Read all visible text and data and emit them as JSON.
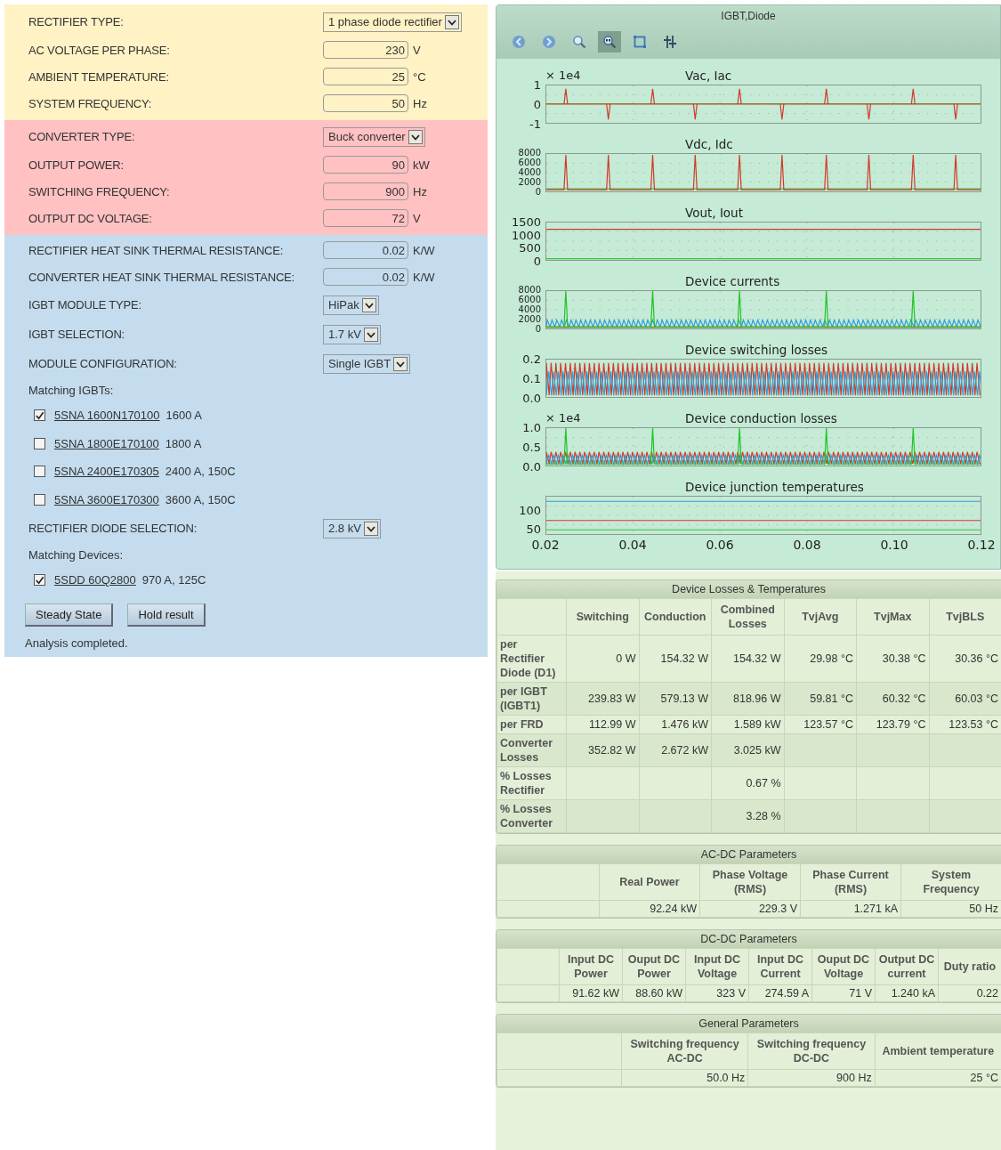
{
  "input_panel": {
    "sections": [
      {
        "color": "#fff2c4",
        "rows": [
          {
            "kind": "select",
            "label": "RECTIFIER TYPE:",
            "value": "1 phase diode rectifier"
          },
          {
            "kind": "number",
            "label": "AC VOLTAGE PER PHASE:",
            "value": "230",
            "unit": "V"
          },
          {
            "kind": "number",
            "label": "AMBIENT TEMPERATURE:",
            "value": "25",
            "unit": "°C"
          },
          {
            "kind": "number",
            "label": "SYSTEM FREQUENCY:",
            "value": "50",
            "unit": "Hz"
          }
        ]
      },
      {
        "color": "#ffc1c1",
        "rows": [
          {
            "kind": "select",
            "label": "CONVERTER TYPE:",
            "value": "Buck converter"
          },
          {
            "kind": "number",
            "label": "OUTPUT POWER:",
            "value": "90",
            "unit": "kW"
          },
          {
            "kind": "number",
            "label": "SWITCHING FREQUENCY:",
            "value": "900",
            "unit": "Hz"
          },
          {
            "kind": "number",
            "label": "OUTPUT DC VOLTAGE:",
            "value": "72",
            "unit": "V"
          }
        ]
      },
      {
        "color": "#c4dcee",
        "rows": [
          {
            "kind": "number",
            "label": "RECTIFIER HEAT SINK THERMAL RESISTANCE:",
            "value": "0.02",
            "unit": "K/W"
          },
          {
            "kind": "number",
            "label": "CONVERTER HEAT SINK THERMAL RESISTANCE:",
            "value": "0.02",
            "unit": "K/W"
          },
          {
            "kind": "select",
            "label": "IGBT MODULE TYPE:",
            "value": "HiPak"
          },
          {
            "kind": "select",
            "label": "IGBT SELECTION:",
            "value": "1.7 kV"
          },
          {
            "kind": "select",
            "label": "MODULE CONFIGURATION:",
            "value": "Single IGBT"
          },
          {
            "kind": "heading",
            "label": "Matching IGBTs:"
          },
          {
            "kind": "checkbox",
            "part": "5SNA 1600N170100",
            "rating": "1600 A",
            "checked": true
          },
          {
            "kind": "checkbox",
            "part": "5SNA 1800E170100",
            "rating": "1800 A",
            "checked": false
          },
          {
            "kind": "checkbox",
            "part": "5SNA 2400E170305",
            "rating": "2400 A, 150C",
            "checked": false
          },
          {
            "kind": "checkbox",
            "part": "5SNA 3600E170300",
            "rating": "3600 A, 150C",
            "checked": false
          },
          {
            "kind": "select",
            "label": "RECTIFIER DIODE SELECTION:",
            "value": "2.8 kV"
          },
          {
            "kind": "heading",
            "label": "Matching Devices:"
          },
          {
            "kind": "checkbox",
            "part": "5SDD 60Q2800",
            "rating": "970 A, 125C",
            "checked": true
          }
        ],
        "buttons": [
          "Steady State",
          "Hold result"
        ],
        "status": "Analysis completed."
      }
    ]
  },
  "plot_panel": {
    "title": "IGBT,Diode",
    "toolbar": [
      {
        "kind": "back",
        "selected": false
      },
      {
        "kind": "forward",
        "selected": false
      },
      {
        "kind": "zoom",
        "selected": false
      },
      {
        "kind": "zoom-rect",
        "selected": true
      },
      {
        "kind": "fit",
        "selected": false
      },
      {
        "kind": "adjust",
        "selected": false
      }
    ],
    "plots": [
      {
        "kind": "ac",
        "title": "Vac, Iac",
        "multiplier": "× 1e4",
        "yticks": [
          "1",
          "0",
          "-1"
        ]
      },
      {
        "kind": "dc",
        "title": "Vdc, Idc",
        "yticks": [
          "8000",
          "6000",
          "4000",
          "2000",
          "0"
        ]
      },
      {
        "kind": "flat",
        "title": "Vout, Iout",
        "yticks": [
          "1500",
          "1000",
          "500",
          "0"
        ]
      },
      {
        "kind": "currents",
        "title": "Device currents",
        "yticks": [
          "8000",
          "6000",
          "4000",
          "2000",
          "0"
        ]
      },
      {
        "kind": "switching",
        "title": "Device switching losses",
        "yticks": [
          "0.2",
          "0.1",
          "0.0"
        ]
      },
      {
        "kind": "conduction",
        "title": "Device conduction losses",
        "multiplier": "× 1e4",
        "yticks": [
          "1.0",
          "0.5",
          "0.0"
        ]
      },
      {
        "kind": "temperatures",
        "title": "Device junction temperatures",
        "yticks": [
          "100",
          "50"
        ]
      }
    ],
    "xticks": [
      "0.02",
      "0.04",
      "0.06",
      "0.08",
      "0.10",
      "0.12"
    ]
  },
  "tables": [
    {
      "title": "Device Losses & Temperatures",
      "columns": [
        "Switching",
        "Conduction",
        "Combined Losses",
        "TvjAvg",
        "TvjMax",
        "TvjBLS"
      ],
      "rows": [
        {
          "label": "per Rectifier Diode (D1)",
          "cells": [
            "0 W",
            "154.32 W",
            "154.32 W",
            "29.98 °C",
            "30.38 °C",
            "30.36 °C"
          ]
        },
        {
          "label": "per IGBT (IGBT1)",
          "cells": [
            "239.83 W",
            "579.13 W",
            "818.96 W",
            "59.81 °C",
            "60.32 °C",
            "60.03 °C"
          ]
        },
        {
          "label": "per FRD",
          "cells": [
            "112.99 W",
            "1.476 kW",
            "1.589 kW",
            "123.57 °C",
            "123.79 °C",
            "123.53 °C"
          ]
        },
        {
          "label": "Converter Losses",
          "cells": [
            "352.82 W",
            "2.672 kW",
            "3.025 kW",
            null,
            null,
            null
          ]
        },
        {
          "label": "% Losses Rectifier",
          "cells": [
            null,
            null,
            "0.67 %",
            null,
            null,
            null
          ]
        },
        {
          "label": "% Losses Converter",
          "cells": [
            null,
            null,
            "3.28 %",
            null,
            null,
            null
          ]
        }
      ]
    },
    {
      "title": "AC-DC Parameters",
      "columns": [
        "Real Power",
        "Phase Voltage (RMS)",
        "Phase Current (RMS)",
        "System Frequency"
      ],
      "rows": [
        {
          "cells": [
            "92.24 kW",
            "229.3 V",
            "1.271 kA",
            "50 Hz"
          ]
        }
      ]
    },
    {
      "title": "DC-DC Parameters",
      "columns": [
        "Input DC Power",
        "Ouput DC Power",
        "Input DC Voltage",
        "Input DC Current",
        "Ouput DC Voltage",
        "Output DC current",
        "Duty ratio"
      ],
      "rows": [
        {
          "cells": [
            "91.62 kW",
            "88.60 kW",
            "323 V",
            "274.59 A",
            "71 V",
            "1.240 kA",
            "0.22"
          ]
        }
      ]
    },
    {
      "title": "General Parameters",
      "columns": [
        "Switching frequency AC-DC",
        "Switching frequency DC-DC",
        "Ambient temperature"
      ],
      "rows": [
        {
          "cells": [
            "50.0 Hz",
            "900 Hz",
            "25 °C"
          ]
        }
      ]
    }
  ]
}
